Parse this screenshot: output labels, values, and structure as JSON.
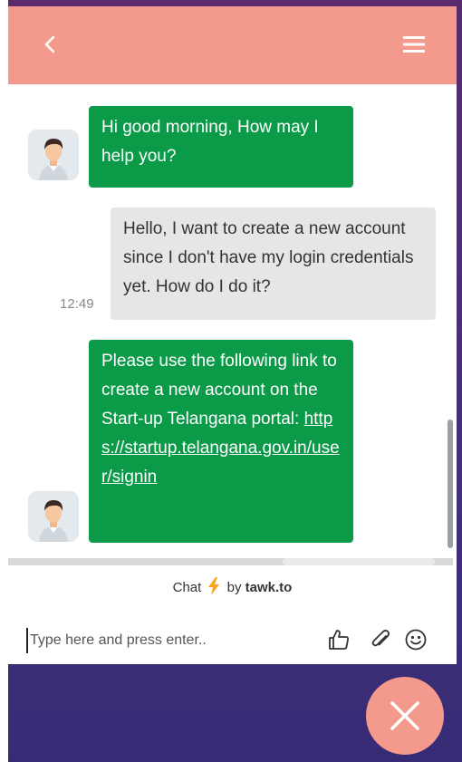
{
  "colors": {
    "header": "#f49a8c",
    "agent_bubble": "#0b9a48",
    "user_bubble": "#e6e6e6",
    "fab": "#f49a8c"
  },
  "header": {
    "back_icon": "chevron-left-icon",
    "menu_icon": "hamburger-menu-icon"
  },
  "messages": [
    {
      "sender": "agent",
      "text": "Hi good morning, How may I help you?"
    },
    {
      "sender": "user",
      "text": "Hello, I want to create a new account since I don't have my login credentials yet. How do I do it?",
      "time": "12:49"
    },
    {
      "sender": "agent",
      "text": "Please use the following link to create a new account on the Start-up Telangana portal: ",
      "link": "https://startup.telangana.gov.in/user/signin"
    }
  ],
  "branding": {
    "prefix": "Chat",
    "by": "by",
    "brand": "tawk.to"
  },
  "composer": {
    "placeholder": "Type here and press enter..",
    "icons": [
      "thumbs-up-icon",
      "paperclip-icon",
      "emoji-icon"
    ]
  },
  "fab": {
    "icon": "close-icon"
  }
}
